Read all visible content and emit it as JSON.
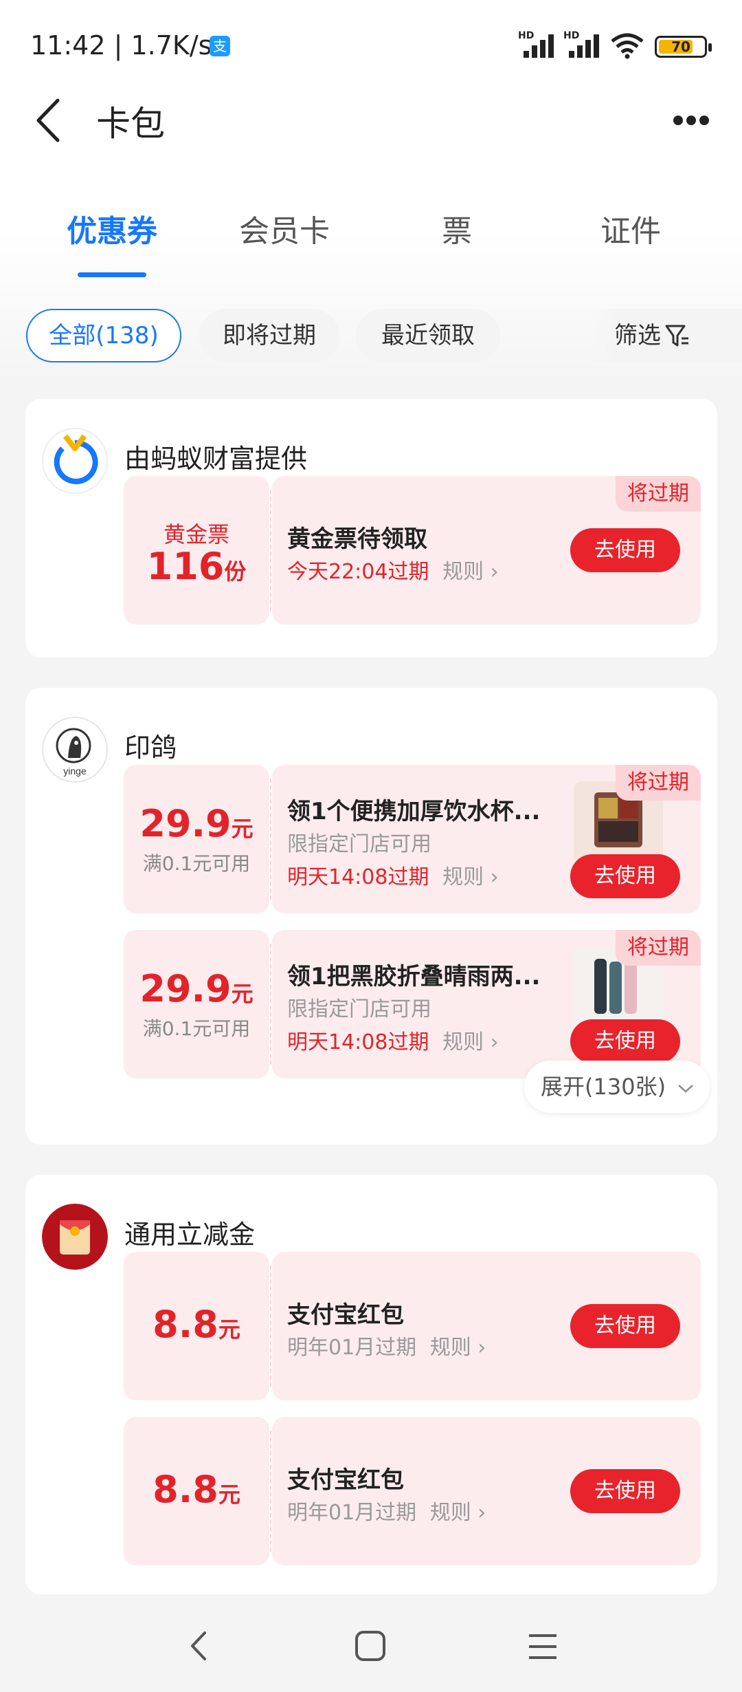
{
  "status_bar": {
    "time_speed": "11:42 | 1.7K/s",
    "alipay_badge": "支",
    "signal1_label": "HD",
    "signal2_label": "HD",
    "battery_level": "70"
  },
  "header": {
    "title": "卡包"
  },
  "tabs": [
    {
      "label": "优惠券",
      "active": true
    },
    {
      "label": "会员卡",
      "active": false
    },
    {
      "label": "票",
      "active": false
    },
    {
      "label": "证件",
      "active": false
    }
  ],
  "filters": {
    "chips": [
      "全部(138)",
      "即将过期",
      "最近领取"
    ],
    "filter_label": "筛选"
  },
  "groups": [
    {
      "merchant": "由蚂蚁财富提供",
      "coupons": [
        {
          "value_label": "黄金票",
          "value_number": "116",
          "value_unit": "份",
          "title": "黄金票待领取",
          "expiry": "今天22:04过期",
          "rule": "规则",
          "button": "去使用",
          "badge": "将过期"
        }
      ]
    },
    {
      "merchant": "印鸽",
      "coupons": [
        {
          "value_number": "29.9",
          "value_unit": "元",
          "condition": "满0.1元可用",
          "title": "领1个便携加厚饮水杯...",
          "limit": "限指定门店可用",
          "expiry": "明天14:08过期",
          "rule": "规则",
          "button": "去使用",
          "badge": "将过期"
        },
        {
          "value_number": "29.9",
          "value_unit": "元",
          "condition": "满0.1元可用",
          "title": "领1把黑胶折叠晴雨两...",
          "limit": "限指定门店可用",
          "expiry": "明天14:08过期",
          "rule": "规则",
          "button": "去使用",
          "badge": "将过期"
        }
      ],
      "expand_label": "展开(130张)"
    },
    {
      "merchant": "通用立减金",
      "coupons": [
        {
          "value_number": "8.8",
          "value_unit": "元",
          "title": "支付宝红包",
          "expiry": "明年01月过期",
          "rule": "规则",
          "button": "去使用"
        },
        {
          "value_number": "8.8",
          "value_unit": "元",
          "title": "支付宝红包",
          "expiry": "明年01月过期",
          "rule": "规则",
          "button": "去使用"
        }
      ]
    }
  ],
  "colors": {
    "accent_blue": "#1677ff",
    "coupon_red": "#e2232a",
    "coupon_bg": "#fdecee"
  }
}
